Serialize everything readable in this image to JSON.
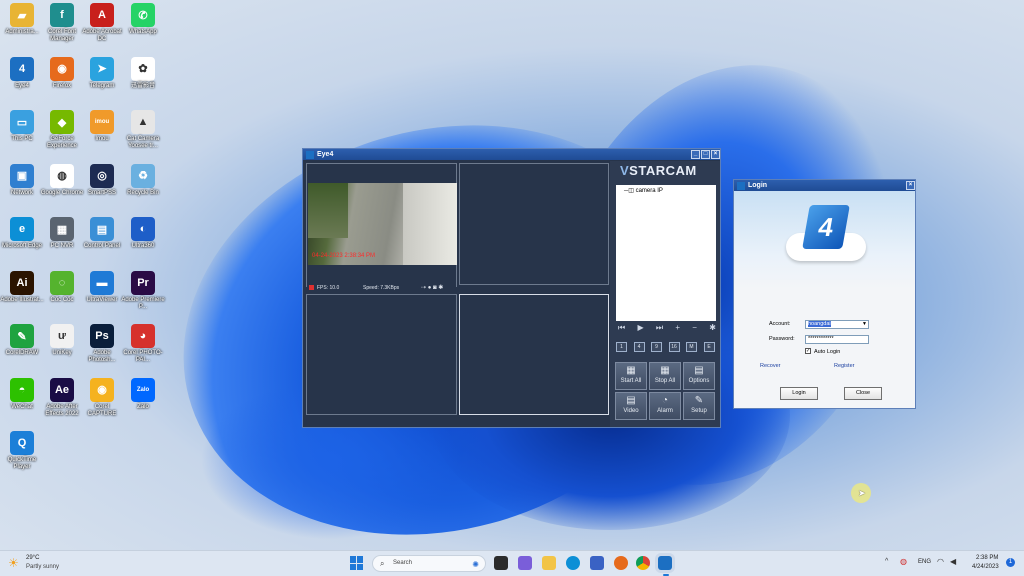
{
  "desktop_icons": [
    {
      "label": "Administra...",
      "color": "#e8b434",
      "glyph": "▰"
    },
    {
      "label": "Corel Font Manager",
      "color": "#1f8e8e",
      "glyph": "f"
    },
    {
      "label": "Adobe Acrobat DC",
      "color": "#c8201c",
      "glyph": "A"
    },
    {
      "label": "WhatsApp",
      "color": "#25d366",
      "glyph": "✆"
    },
    {
      "label": "Eye4",
      "color": "#1c6fc2",
      "glyph": "4"
    },
    {
      "label": "Firefox",
      "color": "#e66a1c",
      "glyph": "◉"
    },
    {
      "label": "Telegram",
      "color": "#2aa3df",
      "glyph": "➤"
    },
    {
      "label": "迅雷影音",
      "color": "#ffffff",
      "glyph": "✿"
    },
    {
      "label": "This PC",
      "color": "#3aa0e0",
      "glyph": "▭"
    },
    {
      "label": "GeForce Experience",
      "color": "#76b900",
      "glyph": "◆"
    },
    {
      "label": "Imou",
      "color": "#f09a2a",
      "glyph": "imou"
    },
    {
      "label": "Cat Camera Yoosee tr...",
      "color": "#e6e6e6",
      "glyph": "▲"
    },
    {
      "label": "Network",
      "color": "#2f7fd0",
      "glyph": "▣"
    },
    {
      "label": "Google Chrome",
      "color": "#ffffff",
      "glyph": "◍"
    },
    {
      "label": "SmartPSS",
      "color": "#1d2b52",
      "glyph": "◎"
    },
    {
      "label": "Recycle Bin",
      "color": "#6ab0e0",
      "glyph": "♻"
    },
    {
      "label": "Microsoft Edge",
      "color": "#0c8fd6",
      "glyph": "e"
    },
    {
      "label": "PC NVR",
      "color": "#5a6470",
      "glyph": "▦"
    },
    {
      "label": "Control Panel",
      "color": "#3a8fd6",
      "glyph": "▤"
    },
    {
      "label": "Ultra360",
      "color": "#1e5ec8",
      "glyph": "◐"
    },
    {
      "label": "Adobe Illustrat...",
      "color": "#2b1400",
      "glyph": "Ai"
    },
    {
      "label": "Cốc Cốc",
      "color": "#55b32e",
      "glyph": "◌"
    },
    {
      "label": "UltraViewer",
      "color": "#1f7ad6",
      "glyph": "▬"
    },
    {
      "label": "Adobe Premiere P...",
      "color": "#2a0b45",
      "glyph": "Pr"
    },
    {
      "label": "CorelDRAW",
      "color": "#1fa340",
      "glyph": "✎"
    },
    {
      "label": "UniKey",
      "color": "#f1f1f1",
      "glyph": "ư"
    },
    {
      "label": "Adobe Photosh...",
      "color": "#0a1e3b",
      "glyph": "Ps"
    },
    {
      "label": "Corel PHOTO-PAI...",
      "color": "#d6312c",
      "glyph": "◕"
    },
    {
      "label": "WeChat",
      "color": "#2dc100",
      "glyph": "◓"
    },
    {
      "label": "Adobe After Effects 2022",
      "color": "#1a0c45",
      "glyph": "Ae"
    },
    {
      "label": "Corel CAPTURE",
      "color": "#f5b21f",
      "glyph": "◉"
    },
    {
      "label": "Zalo",
      "color": "#0068ff",
      "glyph": "Zalo"
    },
    {
      "label": "QuickTime Player",
      "color": "#1c7fd8",
      "glyph": "Q"
    }
  ],
  "eye4": {
    "title": "Eye4",
    "brand": "STARCAM",
    "tree_item": "camera IP",
    "timestamp": "04-24-2023 2:38:34 PM",
    "fps": "FPS: 10.0",
    "speed": "Speed: 7.3KBps",
    "buttons": [
      "Start All",
      "Stop All",
      "Options",
      "Video",
      "Alarm",
      "Setup"
    ],
    "layout_buttons": [
      "1",
      "4",
      "9",
      "16",
      "M",
      "E"
    ]
  },
  "login": {
    "title": "Login",
    "account_label": "Account:",
    "account_value": "hoangdai",
    "password_label": "Password:",
    "password_value": "************",
    "auto_login": "Auto Login",
    "recover": "Recover",
    "register": "Register",
    "login_button": "Login",
    "close_button": "Close"
  },
  "taskbar": {
    "weather_temp": "29°C",
    "weather_desc": "Partly sunny",
    "search_placeholder": "Search",
    "lang": "ENG",
    "time": "2:38 PM",
    "date": "4/24/2023"
  }
}
